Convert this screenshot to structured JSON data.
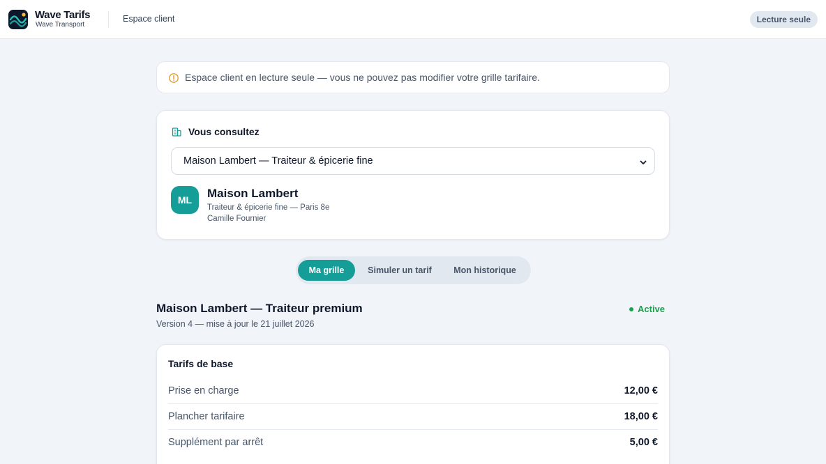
{
  "header": {
    "brand_title": "Wave Tarifs",
    "brand_subtitle": "Wave Transport",
    "nav_link": "Espace client",
    "badge": "Lecture seule"
  },
  "notice": {
    "text": "Espace client en lecture seule — vous ne pouvez pas modifier votre grille tarifaire.",
    "icon": "alert-circle-icon"
  },
  "client_selector": {
    "heading": "Vous consultez",
    "selected": "Maison Lambert — Traiteur & épicerie fine",
    "client": {
      "initials": "ML",
      "name": "Maison Lambert",
      "description": "Traiteur & épicerie fine — Paris 8e",
      "contact": "Camille Fournier"
    }
  },
  "tabs": [
    {
      "label": "Ma grille",
      "active": true
    },
    {
      "label": "Simuler un tarif",
      "active": false
    },
    {
      "label": "Mon historique",
      "active": false
    }
  ],
  "grid": {
    "title": "Maison Lambert — Traiteur premium",
    "version": "Version 4 — mise à jour le 21 juillet 2026",
    "status": "Active"
  },
  "base_rates": {
    "heading": "Tarifs de base",
    "rows": [
      {
        "label": "Prise en charge",
        "value": "12,00 €"
      },
      {
        "label": "Plancher tarifaire",
        "value": "18,00 €"
      },
      {
        "label": "Supplément par arrêt",
        "value": "5,00 €"
      }
    ]
  },
  "colors": {
    "accent": "#159e98",
    "status_active": "#16a34a",
    "notice_icon": "#e0a030"
  }
}
